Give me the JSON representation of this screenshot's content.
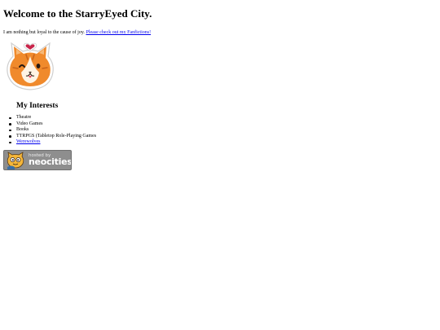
{
  "page": {
    "title": "Welcome to the StarryEyed City.",
    "intro_text": "I am nothing but loyal to the cause of joy. ",
    "intro_link": "Please check out my Fanfictions!"
  },
  "mascot": {
    "icon": "cat-face-heart-sticker",
    "colors": {
      "fur": "#f08a2c",
      "heart": "#c8244a"
    }
  },
  "interests": {
    "heading": "My Interests",
    "items": [
      {
        "label": "Theatre",
        "link": false
      },
      {
        "label": "Video Games",
        "link": false
      },
      {
        "label": "Books",
        "link": false
      },
      {
        "label": "TTRPGS (Tabletop Role-Playing Games",
        "link": false
      },
      {
        "label": "Werewolves",
        "link": true
      }
    ]
  },
  "badge": {
    "small_text": "hosted by",
    "brand_text": "neocities",
    "icon": "neocities-cat-icon"
  },
  "colors": {
    "link": "#0000ee",
    "badge_bg": "#8e8e8e"
  }
}
